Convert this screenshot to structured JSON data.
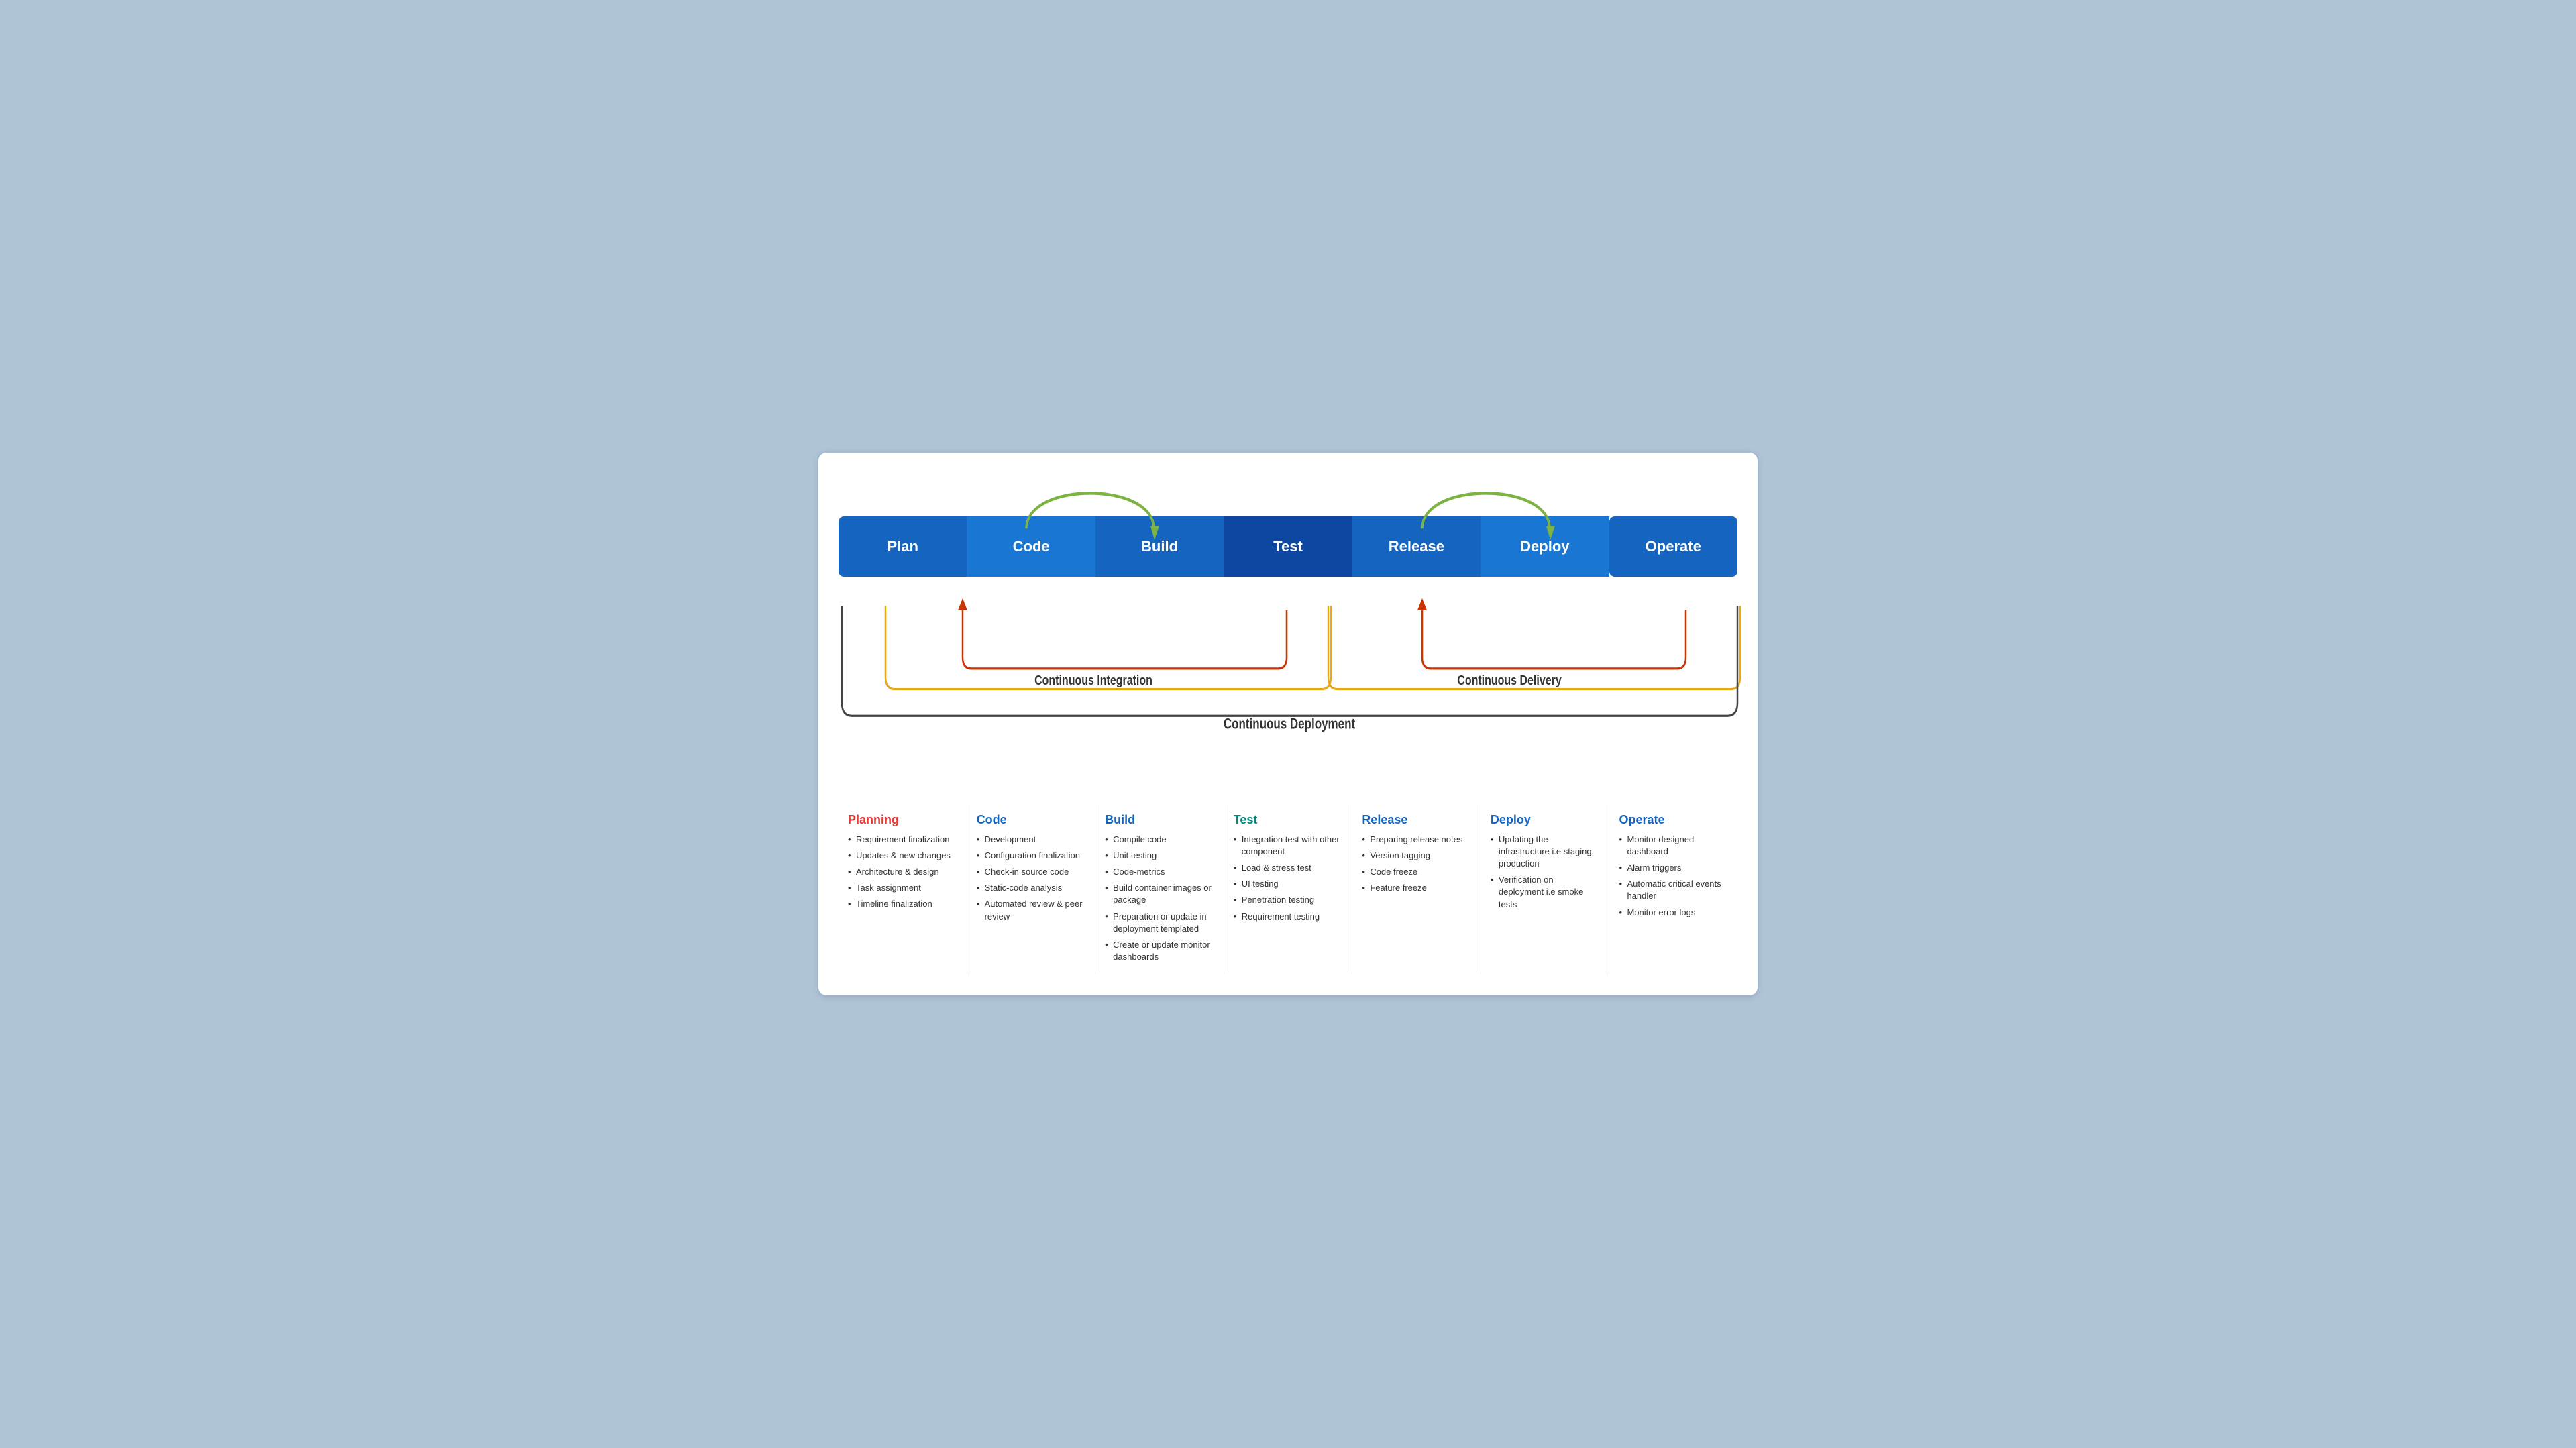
{
  "pipeline": {
    "boxes": [
      {
        "id": "plan",
        "label": "Plan",
        "shape": "first"
      },
      {
        "id": "code",
        "label": "Code",
        "shape": "arrow"
      },
      {
        "id": "build",
        "label": "Build",
        "shape": "arrow"
      },
      {
        "id": "test",
        "label": "Test",
        "shape": "arrow"
      },
      {
        "id": "release",
        "label": "Release",
        "shape": "arrow"
      },
      {
        "id": "deploy",
        "label": "Deploy",
        "shape": "arrow"
      },
      {
        "id": "operate",
        "label": "Operate",
        "shape": "last"
      }
    ],
    "ci_label": "Continuous Integration",
    "cd_label": "Continuous Delivery",
    "deployment_label": "Continuous Deployment"
  },
  "columns": [
    {
      "id": "planning",
      "title": "Planning",
      "title_class": "planning-title",
      "items": [
        "Requirement finalization",
        "Updates & new changes",
        "Architecture & design",
        "Task assignment",
        "Timeline finalization"
      ]
    },
    {
      "id": "code",
      "title": "Code",
      "title_class": "code-title",
      "items": [
        "Development",
        "Configuration finalization",
        "Check-in source code",
        "Static-code analysis",
        "Automated review & peer review"
      ]
    },
    {
      "id": "build",
      "title": "Build",
      "title_class": "build-title",
      "items": [
        "Compile code",
        "Unit testing",
        "Code-metrics",
        "Build container images or package",
        "Preparation or update in deployment templated",
        "Create or update monitor dashboards"
      ]
    },
    {
      "id": "test",
      "title": "Test",
      "title_class": "test-title",
      "items": [
        "Integration test with other component",
        "Load & stress test",
        "UI testing",
        "Penetration testing",
        "Requirement testing"
      ]
    },
    {
      "id": "release",
      "title": "Release",
      "title_class": "release-title",
      "items": [
        "Preparing release notes",
        "Version tagging",
        "Code freeze",
        "Feature freeze"
      ]
    },
    {
      "id": "deploy",
      "title": "Deploy",
      "title_class": "deploy-title",
      "items": [
        "Updating the infrastructure i.e staging, production",
        "Verification on deployment i.e smoke tests"
      ]
    },
    {
      "id": "operate",
      "title": "Operate",
      "title_class": "operate-title",
      "items": [
        "Monitor designed dashboard",
        "Alarm triggers",
        "Automatic critical events handler",
        "Monitor error logs"
      ]
    }
  ]
}
